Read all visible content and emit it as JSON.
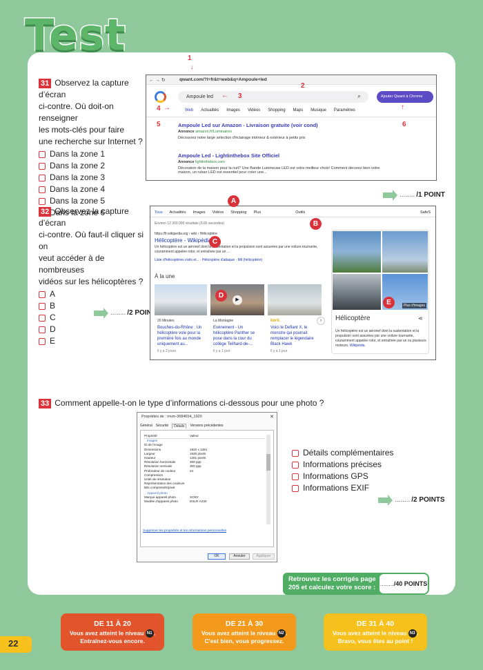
{
  "page_title": "Test",
  "page_number": "22",
  "q31": {
    "num": "31",
    "lines": [
      "Observez la capture d’écran",
      "ci-contre. Où doit-on renseigner",
      "les mots-clés pour faire",
      "une recherche sur Internet ?"
    ],
    "options": [
      "Dans la zone 1",
      "Dans la zone 2",
      "Dans la zone 3",
      "Dans la zone 4",
      "Dans la zone 5",
      "Dans la zone 6"
    ],
    "points": "/1 POINT"
  },
  "q32": {
    "num": "32",
    "lines": [
      "Observez la capture d’écran",
      "ci-contre. Où faut-il cliquer si on",
      "veut accéder à de nombreuses",
      "vidéos sur les hélicoptères ?"
    ],
    "options": [
      "A",
      "B",
      "C",
      "D",
      "E"
    ],
    "points": "/2 POINTS"
  },
  "q33": {
    "num": "33",
    "text": "Comment appelle-t-on le type d’informations ci-dessous pour une photo ?",
    "options": [
      "Détails complémentaires",
      "Informations précises",
      "Informations GPS",
      "Informations EXIF"
    ],
    "points": "/2 POINTS"
  },
  "dots": "........",
  "qwant": {
    "url": "qwant.com/?l=fr&t=web&q=Ampoule+led",
    "search_value": "Ampoule led",
    "add_button": "Ajouter Qwant à Chrome",
    "tabs": [
      "Web",
      "Actualités",
      "Images",
      "Vidéos",
      "Shopping",
      "Maps",
      "Musique",
      "Paramètres"
    ],
    "results": [
      {
        "title": "Ampoule Led sur Amazon - Livraison gratuite (voir cond)",
        "ad": "Annonce",
        "url": "amazon.fr/Luminaires",
        "desc": "Découvrez notre large sélection d'éclairage intérieur & extérieur à petits prix"
      },
      {
        "title": "Ampoule Led - Lightinthebox Site Officiel",
        "ad": "Annonce",
        "url": "lightinthebox.com",
        "desc": "Décoration de la maison pour la nuit? Une Bande Lumineuse LED est votre meilleur choix! Comment décorez bien votre maison, un ruban LED est essentiel pour créer une..."
      }
    ],
    "zones": [
      "1",
      "2",
      "3",
      "4",
      "5",
      "6"
    ]
  },
  "google": {
    "tabs": [
      "Tous",
      "Actualités",
      "Images",
      "Vidéos",
      "Shopping",
      "Plus",
      "Outils",
      "SafeS"
    ],
    "result_count": "Environ 12 300 000 résultats (0,65 secondes)",
    "wiki_url": "https://fr.wikipedia.org › wiki › Hélicoptère",
    "wiki_title": "Hélicoptère - Wikipédia",
    "wiki_desc": "Un hélicoptère est un aéronef dont la sustentation et la propulsion sont assurées par une voilure tournante, couramment appelée rotor, et entraînée par un ...",
    "wiki_links": "Liste d'hélicoptères civils et... · Hélicoptère d'attaque · Mil (hélicoptère)",
    "news_heading": "À la une",
    "news": [
      {
        "source": "20 Minutes",
        "title": "Bouches-du-Rhône : Un hélicoptère vole pour la première fois au monde uniquement au...",
        "time": "Il y a 2 jours"
      },
      {
        "source": "La Montagne",
        "title": "Evénement - Un hélicoptère Panther se pose dans la cour du collège Teilhard-de-...",
        "time": "Il y a 1 jour"
      },
      {
        "source": "korii.",
        "title": "Voici le Defiant X, le monstre qui pourrait remplacer le légendaire Black Hawk",
        "time": "Il y a 1 jour"
      }
    ],
    "kp_title": "Hélicoptère",
    "kp_desc": "Un hélicoptère est un aéronef dont la sustentation et la propulsion sont assurées par une voilure tournante, couramment appelée rotor, et entraînée par un ou plusieurs moteurs.",
    "kp_source": "Wikipédia",
    "more_images": "Plus d'images",
    "zones": [
      "A",
      "B",
      "C",
      "D",
      "E"
    ]
  },
  "props": {
    "title": "Propriétés de : mvm-3684654_1920",
    "tabs": [
      "Général",
      "Sécurité",
      "Détails",
      "Versions précédentes"
    ],
    "col_property": "Propriété",
    "col_value": "Valeur",
    "section1": "Images",
    "rows1": [
      [
        "ID de l'image",
        ""
      ],
      [
        "Dimensions",
        "1920 x 1281"
      ],
      [
        "Largeur",
        "1920 pixels"
      ],
      [
        "Hauteur",
        "1281 pixels"
      ],
      [
        "Résolution horizontale",
        "300 ppp"
      ],
      [
        "Résolution verticale",
        "300 ppp"
      ],
      [
        "Profondeur de couleur",
        "24"
      ],
      [
        "Compression",
        ""
      ],
      [
        "Unité de résolution",
        ""
      ],
      [
        "Représentation des couleurs",
        ""
      ],
      [
        "Bits compressés/pixel",
        ""
      ]
    ],
    "section2": "Appareil photo",
    "rows2": [
      [
        "Marque appareil photo",
        "SONY"
      ],
      [
        "Modèle d'appareil photo",
        "DSLR-A230"
      ]
    ],
    "link": "Supprimer les propriétés et les informations personnelles",
    "ok": "OK",
    "cancel": "Annuler",
    "apply": "Appliquer"
  },
  "score": {
    "text": "Retrouvez les corrigés page 205 et calculez votre score :",
    "points": "/40 POINTS"
  },
  "levels": [
    {
      "range": "DE 11 À 20",
      "line1": "Vous avez atteint le niveau",
      "badge": "N1",
      "line2": "Entraînez-vous encore.",
      "color": "#e2542c"
    },
    {
      "range": "DE 21 À 30",
      "line1": "Vous avez atteint le niveau",
      "badge": "N2",
      "line2": "C'est bien, vous progressez.",
      "color": "#f39a1c"
    },
    {
      "range": "DE 31 À 40",
      "line1": "Vous avez atteint le niveau",
      "badge": "N3",
      "line2": "Bravo, vous êtes au point !",
      "color": "#f6c11d"
    }
  ]
}
